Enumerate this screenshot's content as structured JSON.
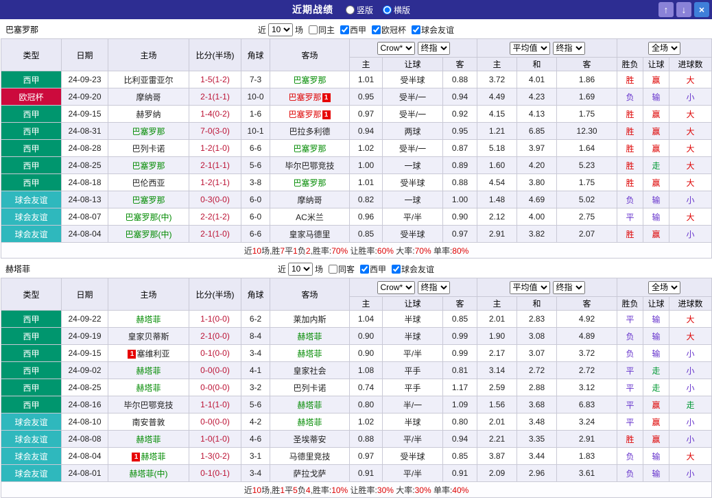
{
  "titlebar": {
    "title": "近期战绩",
    "layout_options": [
      {
        "label": "竖版",
        "checked": false
      },
      {
        "label": "横版",
        "checked": true
      }
    ],
    "buttons": {
      "up": "↑",
      "down": "↓",
      "close": "×"
    }
  },
  "colors": {
    "titlebar_bg": "#2d2d92",
    "btn_move_bg": "#8a82d8",
    "btn_close_bg": "#3f7fd9",
    "score": "#bb1133",
    "league": {
      "西甲": "#00966e",
      "欧冠杯": "#cc0a3d",
      "球会友谊": "#2fb8bd"
    },
    "text": {
      "k": "#222222",
      "g": "#008a00",
      "r": "#dd0000",
      "p": "#6633cc",
      "gn": "#009933"
    }
  },
  "sections": [
    {
      "team": "巴塞罗那",
      "filters": {
        "near_label": "近",
        "count": "10",
        "games_label": "场",
        "checkboxes": [
          {
            "label": "同主",
            "checked": false
          },
          {
            "label": "西甲",
            "checked": true
          },
          {
            "label": "欧冠杯",
            "checked": true
          },
          {
            "label": "球会友谊",
            "checked": true
          }
        ]
      },
      "header": {
        "cols": [
          "类型",
          "日期",
          "主场",
          "比分(半场)",
          "角球",
          "客场"
        ],
        "groups": [
          {
            "selects": [
              "Crow*",
              "终指"
            ],
            "sub": [
              "主",
              "让球",
              "客"
            ]
          },
          {
            "selects": [
              "平均值",
              "终指"
            ],
            "sub": [
              "主",
              "和",
              "客"
            ]
          },
          {
            "selects": [
              "全场"
            ],
            "sub": [
              "胜负",
              "让球",
              "进球数"
            ]
          }
        ]
      },
      "rows": [
        {
          "lg": "西甲",
          "date": "24-09-23",
          "home": {
            "n": "比利亚雷亚尔",
            "c": "k"
          },
          "score": "1-5(1-2)",
          "corner": "7-3",
          "away": {
            "n": "巴塞罗那",
            "c": "g"
          },
          "o1": [
            "1.01",
            "受半球",
            "0.88"
          ],
          "o2": [
            "3.72",
            "4.01",
            "1.86"
          ],
          "res": [
            [
              "胜",
              "r"
            ],
            [
              "赢",
              "r"
            ],
            [
              "大",
              "r"
            ]
          ]
        },
        {
          "lg": "欧冠杯",
          "date": "24-09-20",
          "home": {
            "n": "摩纳哥",
            "c": "k"
          },
          "score": "2-1(1-1)",
          "corner": "10-0",
          "away": {
            "n": "巴塞罗那",
            "c": "r",
            "badge": "1",
            "bp": "after"
          },
          "o1": [
            "0.95",
            "受半/一",
            "0.94"
          ],
          "o2": [
            "4.49",
            "4.23",
            "1.69"
          ],
          "res": [
            [
              "负",
              "p"
            ],
            [
              "输",
              "p"
            ],
            [
              "小",
              "p"
            ]
          ]
        },
        {
          "lg": "西甲",
          "date": "24-09-15",
          "home": {
            "n": "赫罗纳",
            "c": "k"
          },
          "score": "1-4(0-2)",
          "corner": "1-6",
          "away": {
            "n": "巴塞罗那",
            "c": "r",
            "badge": "1",
            "bp": "after"
          },
          "o1": [
            "0.97",
            "受半/一",
            "0.92"
          ],
          "o2": [
            "4.15",
            "4.13",
            "1.75"
          ],
          "res": [
            [
              "胜",
              "r"
            ],
            [
              "赢",
              "r"
            ],
            [
              "大",
              "r"
            ]
          ]
        },
        {
          "lg": "西甲",
          "date": "24-08-31",
          "home": {
            "n": "巴塞罗那",
            "c": "g"
          },
          "score": "7-0(3-0)",
          "corner": "10-1",
          "away": {
            "n": "巴拉多利德",
            "c": "k"
          },
          "o1": [
            "0.94",
            "两球",
            "0.95"
          ],
          "o2": [
            "1.21",
            "6.85",
            "12.30"
          ],
          "res": [
            [
              "胜",
              "r"
            ],
            [
              "赢",
              "r"
            ],
            [
              "大",
              "r"
            ]
          ]
        },
        {
          "lg": "西甲",
          "date": "24-08-28",
          "home": {
            "n": "巴列卡诺",
            "c": "k"
          },
          "score": "1-2(1-0)",
          "corner": "6-6",
          "away": {
            "n": "巴塞罗那",
            "c": "g"
          },
          "o1": [
            "1.02",
            "受半/一",
            "0.87"
          ],
          "o2": [
            "5.18",
            "3.97",
            "1.64"
          ],
          "res": [
            [
              "胜",
              "r"
            ],
            [
              "赢",
              "r"
            ],
            [
              "大",
              "r"
            ]
          ]
        },
        {
          "lg": "西甲",
          "date": "24-08-25",
          "home": {
            "n": "巴塞罗那",
            "c": "g"
          },
          "score": "2-1(1-1)",
          "corner": "5-6",
          "away": {
            "n": "毕尔巴鄂竞技",
            "c": "k"
          },
          "o1": [
            "1.00",
            "一球",
            "0.89"
          ],
          "o2": [
            "1.60",
            "4.20",
            "5.23"
          ],
          "res": [
            [
              "胜",
              "r"
            ],
            [
              "走",
              "gn"
            ],
            [
              "大",
              "r"
            ]
          ]
        },
        {
          "lg": "西甲",
          "date": "24-08-18",
          "home": {
            "n": "巴伦西亚",
            "c": "k"
          },
          "score": "1-2(1-1)",
          "corner": "3-8",
          "away": {
            "n": "巴塞罗那",
            "c": "g"
          },
          "o1": [
            "1.01",
            "受半球",
            "0.88"
          ],
          "o2": [
            "4.54",
            "3.80",
            "1.75"
          ],
          "res": [
            [
              "胜",
              "r"
            ],
            [
              "赢",
              "r"
            ],
            [
              "大",
              "r"
            ]
          ]
        },
        {
          "lg": "球会友谊",
          "date": "24-08-13",
          "home": {
            "n": "巴塞罗那",
            "c": "g"
          },
          "score": "0-3(0-0)",
          "corner": "6-0",
          "away": {
            "n": "摩纳哥",
            "c": "k"
          },
          "o1": [
            "0.82",
            "一球",
            "1.00"
          ],
          "o2": [
            "1.48",
            "4.69",
            "5.02"
          ],
          "res": [
            [
              "负",
              "p"
            ],
            [
              "输",
              "p"
            ],
            [
              "小",
              "p"
            ]
          ]
        },
        {
          "lg": "球会友谊",
          "date": "24-08-07",
          "home": {
            "n": "巴塞罗那(中)",
            "c": "g"
          },
          "score": "2-2(1-2)",
          "corner": "6-0",
          "away": {
            "n": "AC米兰",
            "c": "k"
          },
          "o1": [
            "0.96",
            "平/半",
            "0.90"
          ],
          "o2": [
            "2.12",
            "4.00",
            "2.75"
          ],
          "res": [
            [
              "平",
              "p"
            ],
            [
              "输",
              "p"
            ],
            [
              "大",
              "r"
            ]
          ]
        },
        {
          "lg": "球会友谊",
          "date": "24-08-04",
          "home": {
            "n": "巴塞罗那(中)",
            "c": "g"
          },
          "score": "2-1(1-0)",
          "corner": "6-6",
          "away": {
            "n": "皇家马德里",
            "c": "k"
          },
          "o1": [
            "0.85",
            "受半球",
            "0.97"
          ],
          "o2": [
            "2.91",
            "3.82",
            "2.07"
          ],
          "res": [
            [
              "胜",
              "r"
            ],
            [
              "赢",
              "r"
            ],
            [
              "小",
              "p"
            ]
          ]
        }
      ],
      "summary": [
        [
          "近",
          "k"
        ],
        [
          "10",
          "r"
        ],
        [
          "场,胜",
          "k"
        ],
        [
          "7",
          "r"
        ],
        [
          "平",
          "k"
        ],
        [
          "1",
          "r"
        ],
        [
          "负",
          "k"
        ],
        [
          "2",
          "r"
        ],
        [
          ",胜率:",
          "k"
        ],
        [
          "70%",
          "r"
        ],
        [
          " 让胜率:",
          "k"
        ],
        [
          "60%",
          "r"
        ],
        [
          " 大率:",
          "k"
        ],
        [
          "70%",
          "r"
        ],
        [
          " 单率:",
          "k"
        ],
        [
          "80%",
          "r"
        ]
      ]
    },
    {
      "team": "赫塔菲",
      "filters": {
        "near_label": "近",
        "count": "10",
        "games_label": "场",
        "checkboxes": [
          {
            "label": "同客",
            "checked": false
          },
          {
            "label": "西甲",
            "checked": true
          },
          {
            "label": "球会友谊",
            "checked": true
          }
        ]
      },
      "header": {
        "cols": [
          "类型",
          "日期",
          "主场",
          "比分(半场)",
          "角球",
          "客场"
        ],
        "groups": [
          {
            "selects": [
              "Crow*",
              "终指"
            ],
            "sub": [
              "主",
              "让球",
              "客"
            ]
          },
          {
            "selects": [
              "平均值",
              "终指"
            ],
            "sub": [
              "主",
              "和",
              "客"
            ]
          },
          {
            "selects": [
              "全场"
            ],
            "sub": [
              "胜负",
              "让球",
              "进球数"
            ]
          }
        ]
      },
      "rows": [
        {
          "lg": "西甲",
          "date": "24-09-22",
          "home": {
            "n": "赫塔菲",
            "c": "g"
          },
          "score": "1-1(0-0)",
          "corner": "6-2",
          "away": {
            "n": "莱加内斯",
            "c": "k"
          },
          "o1": [
            "1.04",
            "半球",
            "0.85"
          ],
          "o2": [
            "2.01",
            "2.83",
            "4.92"
          ],
          "res": [
            [
              "平",
              "p"
            ],
            [
              "输",
              "p"
            ],
            [
              "大",
              "r"
            ]
          ]
        },
        {
          "lg": "西甲",
          "date": "24-09-19",
          "home": {
            "n": "皇家贝蒂斯",
            "c": "k"
          },
          "score": "2-1(0-0)",
          "corner": "8-4",
          "away": {
            "n": "赫塔菲",
            "c": "g"
          },
          "o1": [
            "0.90",
            "半球",
            "0.99"
          ],
          "o2": [
            "1.90",
            "3.08",
            "4.89"
          ],
          "res": [
            [
              "负",
              "p"
            ],
            [
              "输",
              "p"
            ],
            [
              "大",
              "r"
            ]
          ]
        },
        {
          "lg": "西甲",
          "date": "24-09-15",
          "home": {
            "n": "塞维利亚",
            "c": "k",
            "badge": "1",
            "bp": "before"
          },
          "score": "0-1(0-0)",
          "corner": "3-4",
          "away": {
            "n": "赫塔菲",
            "c": "g"
          },
          "o1": [
            "0.90",
            "平/半",
            "0.99"
          ],
          "o2": [
            "2.17",
            "3.07",
            "3.72"
          ],
          "res": [
            [
              "负",
              "p"
            ],
            [
              "输",
              "p"
            ],
            [
              "小",
              "p"
            ]
          ]
        },
        {
          "lg": "西甲",
          "date": "24-09-02",
          "home": {
            "n": "赫塔菲",
            "c": "g"
          },
          "score": "0-0(0-0)",
          "corner": "4-1",
          "away": {
            "n": "皇家社会",
            "c": "k"
          },
          "o1": [
            "1.08",
            "平手",
            "0.81"
          ],
          "o2": [
            "3.14",
            "2.72",
            "2.72"
          ],
          "res": [
            [
              "平",
              "p"
            ],
            [
              "走",
              "gn"
            ],
            [
              "小",
              "p"
            ]
          ]
        },
        {
          "lg": "西甲",
          "date": "24-08-25",
          "home": {
            "n": "赫塔菲",
            "c": "g"
          },
          "score": "0-0(0-0)",
          "corner": "3-2",
          "away": {
            "n": "巴列卡诺",
            "c": "k"
          },
          "o1": [
            "0.74",
            "平手",
            "1.17"
          ],
          "o2": [
            "2.59",
            "2.88",
            "3.12"
          ],
          "res": [
            [
              "平",
              "p"
            ],
            [
              "走",
              "gn"
            ],
            [
              "小",
              "p"
            ]
          ]
        },
        {
          "lg": "西甲",
          "date": "24-08-16",
          "home": {
            "n": "毕尔巴鄂竞技",
            "c": "k"
          },
          "score": "1-1(1-0)",
          "corner": "5-6",
          "away": {
            "n": "赫塔菲",
            "c": "g"
          },
          "o1": [
            "0.80",
            "半/一",
            "1.09"
          ],
          "o2": [
            "1.56",
            "3.68",
            "6.83"
          ],
          "res": [
            [
              "平",
              "p"
            ],
            [
              "赢",
              "r"
            ],
            [
              "走",
              "gn"
            ]
          ]
        },
        {
          "lg": "球会友谊",
          "date": "24-08-10",
          "home": {
            "n": "南安普敦",
            "c": "k"
          },
          "score": "0-0(0-0)",
          "corner": "4-2",
          "away": {
            "n": "赫塔菲",
            "c": "g"
          },
          "o1": [
            "1.02",
            "半球",
            "0.80"
          ],
          "o2": [
            "2.01",
            "3.48",
            "3.24"
          ],
          "res": [
            [
              "平",
              "p"
            ],
            [
              "赢",
              "r"
            ],
            [
              "小",
              "p"
            ]
          ]
        },
        {
          "lg": "球会友谊",
          "date": "24-08-08",
          "home": {
            "n": "赫塔菲",
            "c": "g"
          },
          "score": "1-0(1-0)",
          "corner": "4-6",
          "away": {
            "n": "圣埃蒂安",
            "c": "k"
          },
          "o1": [
            "0.88",
            "平/半",
            "0.94"
          ],
          "o2": [
            "2.21",
            "3.35",
            "2.91"
          ],
          "res": [
            [
              "胜",
              "r"
            ],
            [
              "赢",
              "r"
            ],
            [
              "小",
              "p"
            ]
          ]
        },
        {
          "lg": "球会友谊",
          "date": "24-08-04",
          "home": {
            "n": "赫塔菲",
            "c": "g",
            "badge": "1",
            "bp": "before"
          },
          "score": "1-3(0-2)",
          "corner": "3-1",
          "away": {
            "n": "马德里竞技",
            "c": "k"
          },
          "o1": [
            "0.97",
            "受半球",
            "0.85"
          ],
          "o2": [
            "3.87",
            "3.44",
            "1.83"
          ],
          "res": [
            [
              "负",
              "p"
            ],
            [
              "输",
              "p"
            ],
            [
              "大",
              "r"
            ]
          ]
        },
        {
          "lg": "球会友谊",
          "date": "24-08-01",
          "home": {
            "n": "赫塔菲(中)",
            "c": "g"
          },
          "score": "0-1(0-1)",
          "corner": "3-4",
          "away": {
            "n": "萨拉戈萨",
            "c": "k"
          },
          "o1": [
            "0.91",
            "平/半",
            "0.91"
          ],
          "o2": [
            "2.09",
            "2.96",
            "3.61"
          ],
          "res": [
            [
              "负",
              "p"
            ],
            [
              "输",
              "p"
            ],
            [
              "小",
              "p"
            ]
          ]
        }
      ],
      "summary": [
        [
          "近",
          "k"
        ],
        [
          "10",
          "r"
        ],
        [
          "场,胜",
          "k"
        ],
        [
          "1",
          "r"
        ],
        [
          "平",
          "k"
        ],
        [
          "5",
          "r"
        ],
        [
          "负",
          "k"
        ],
        [
          "4",
          "r"
        ],
        [
          ",胜率:",
          "k"
        ],
        [
          "10%",
          "r"
        ],
        [
          " 让胜率:",
          "k"
        ],
        [
          "30%",
          "r"
        ],
        [
          " 大率:",
          "k"
        ],
        [
          "30%",
          "r"
        ],
        [
          " 单率:",
          "k"
        ],
        [
          "40%",
          "r"
        ]
      ]
    }
  ]
}
